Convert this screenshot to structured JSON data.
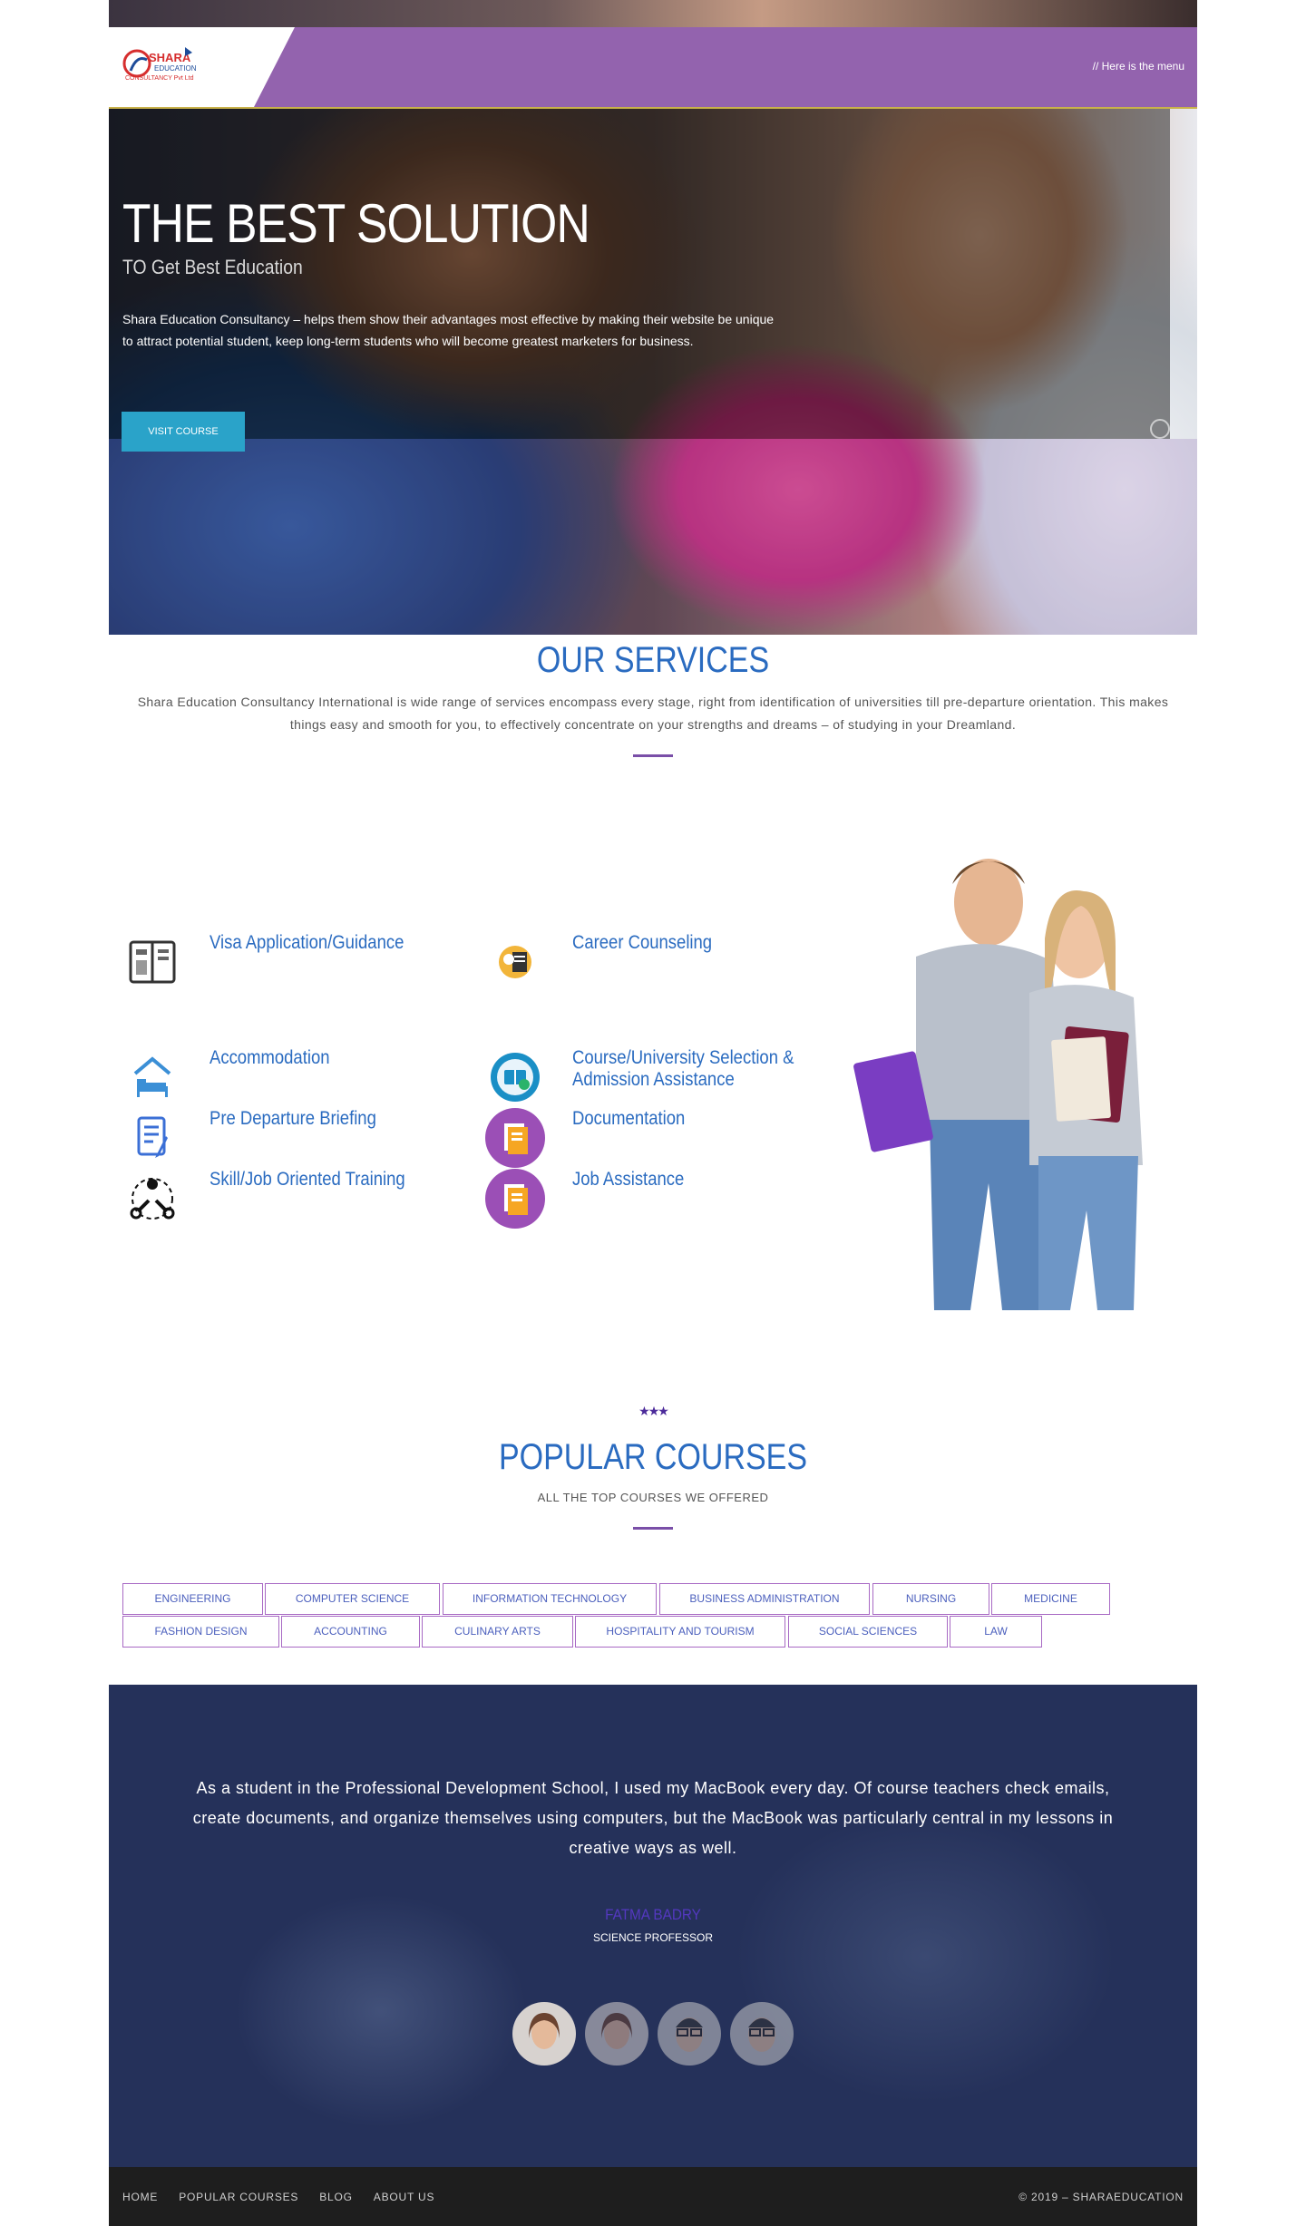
{
  "header": {
    "logo_line1": "SHARA",
    "logo_line2": "EDUCATION",
    "logo_line3": "CONSULTANCY Pvt Ltd",
    "menu_text": "// Here is the menu"
  },
  "hero": {
    "title": "THE BEST SOLUTION",
    "subtitle": "TO Get Best Education",
    "description": "Shara Education Consultancy – helps them show their advantages most effective by making their website be unique to attract potential student, keep long-term students who will become greatest marketers for business.",
    "button_label": "VISIT COURSE"
  },
  "services": {
    "title": "OUR SERVICES",
    "description": "Shara Education Consultancy International is wide range of services encompass every stage, right from identification of universities till pre-departure orientation. This makes things easy and smooth for you, to effectively concentrate on your strengths and dreams – of studying in your Dreamland.",
    "items": [
      {
        "label": "Visa Application/Guidance",
        "icon": "passport-book-icon"
      },
      {
        "label": "Career Counseling",
        "icon": "counseling-icon"
      },
      {
        "label": "Accommodation",
        "icon": "home-bed-icon"
      },
      {
        "label": "Course/University Selection &",
        "label2": "Admission Assistance",
        "icon": "university-book-icon"
      },
      {
        "label": "Pre Departure Briefing",
        "icon": "document-pen-icon"
      },
      {
        "label": "Documentation",
        "icon": "documents-icon"
      },
      {
        "label": "Skill/Job Oriented Training",
        "icon": "skills-tools-icon"
      },
      {
        "label": "Job Assistance",
        "icon": "documents-icon"
      }
    ]
  },
  "popular": {
    "stars": "★★★",
    "title": "POPULAR COURSES",
    "subtitle": "ALL THE TOP COURSES WE OFFERED",
    "tags": [
      "ENGINEERING",
      "COMPUTER SCIENCE",
      "INFORMATION TECHNOLOGY",
      "BUSINESS ADMINISTRATION",
      "NURSING",
      "MEDICINE",
      "FASHION DESIGN",
      "ACCOUNTING",
      "CULINARY ARTS",
      "HOSPITALITY AND TOURISM",
      "SOCIAL SCIENCES",
      "LAW"
    ]
  },
  "testimonial": {
    "quote": "As a student in the Professional Development School, I used my MacBook every day. Of course teachers check emails, create documents, and organize themselves using computers, but the MacBook was particularly central in my lessons in creative ways as well.",
    "name": "FATMA BADRY",
    "role": "SCIENCE PROFESSOR"
  },
  "footer": {
    "nav": [
      "HOME",
      "POPULAR COURSES",
      "BLOG",
      "ABOUT US"
    ],
    "copyright": "© 2019 – SHARAEDUCATION"
  },
  "colors": {
    "header_purple": "#9363ae",
    "heading_blue": "#2a6bc0",
    "button_blue": "#2aa3c9",
    "tag_border": "#a869c4",
    "testimonial_bg": "#25315a",
    "footer_bg": "#1e1e1e"
  }
}
